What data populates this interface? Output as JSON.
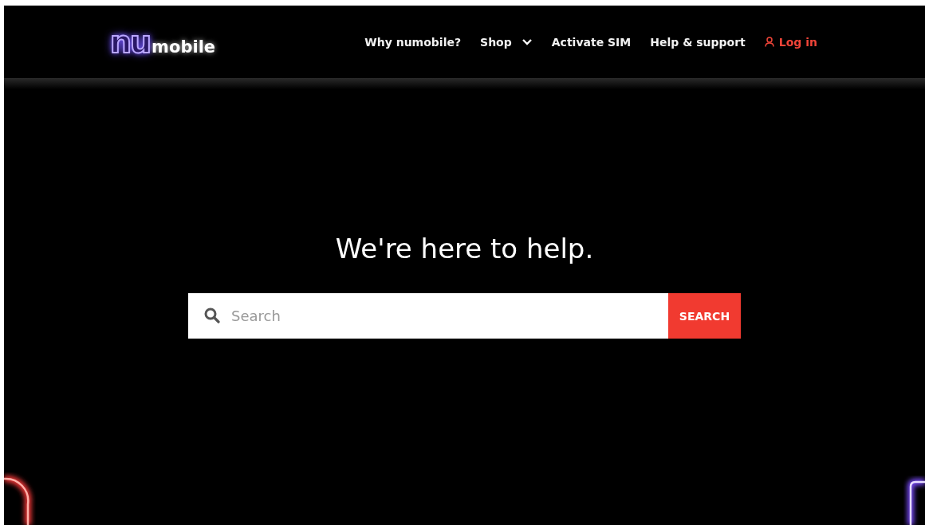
{
  "header": {
    "logo": {
      "mark": "nu",
      "text": "mobile"
    },
    "nav": [
      {
        "kind": "link",
        "label": "Why numobile?"
      },
      {
        "kind": "dropdown",
        "label": "Shop"
      },
      {
        "kind": "link",
        "label": "Activate SIM"
      },
      {
        "kind": "link",
        "label": "Help & support"
      },
      {
        "kind": "login",
        "label": "Log in"
      }
    ]
  },
  "hero": {
    "heading": "We're here to help.",
    "search": {
      "placeholder": "Search",
      "button": "SEARCH"
    }
  }
}
